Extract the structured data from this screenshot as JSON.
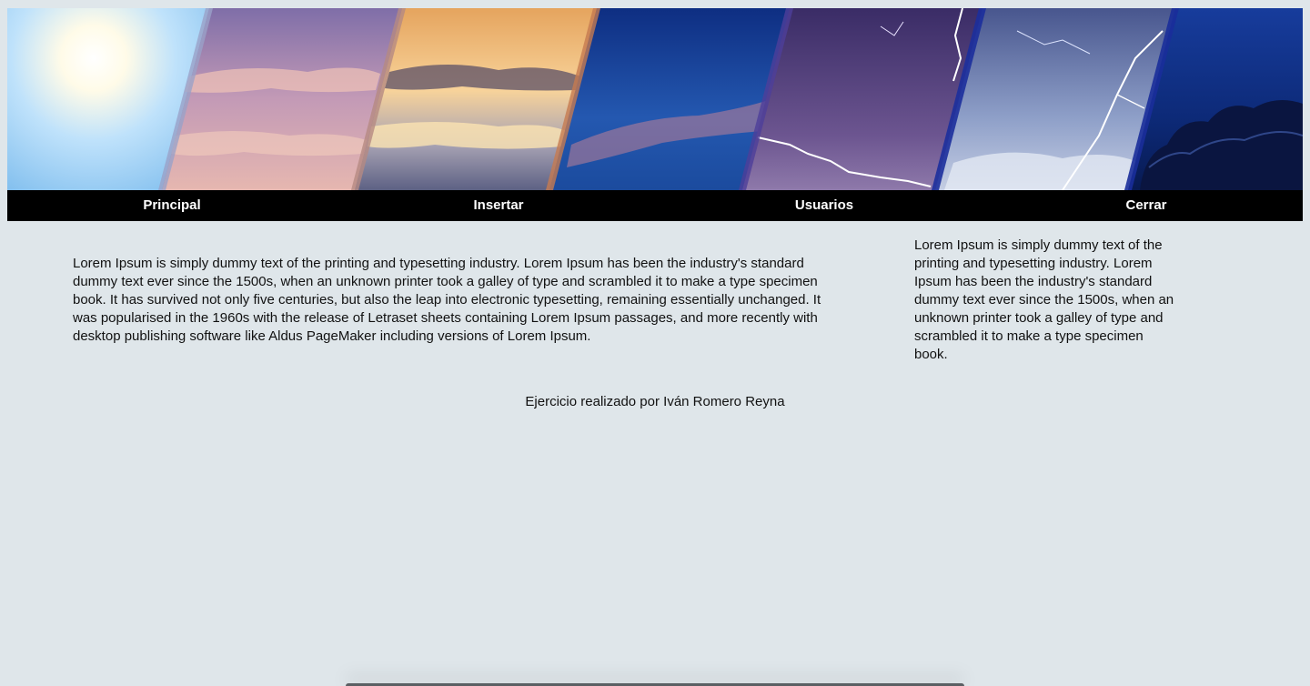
{
  "nav": {
    "items": [
      {
        "label": "Principal"
      },
      {
        "label": "Insertar"
      },
      {
        "label": "Usuarios"
      },
      {
        "label": "Cerrar"
      }
    ]
  },
  "content": {
    "main_paragraph": "Lorem Ipsum is simply dummy text of the printing and typesetting industry. Lorem Ipsum has been the industry's standard dummy text ever since the 1500s, when an unknown printer took a galley of type and scrambled it to make a type specimen book. It has survived not only five centuries, but also the leap into electronic typesetting, remaining essentially unchanged. It was popularised in the 1960s with the release of Letraset sheets containing Lorem Ipsum passages, and more recently with desktop publishing software like Aldus PageMaker including versions of Lorem Ipsum.",
    "side_paragraph": "Lorem Ipsum is simply dummy text of the printing and typesetting industry. Lorem Ipsum has been the industry's standard dummy text ever since the 1500s, when an unknown printer took a galley of type and scrambled it to make a type specimen book.",
    "footer": "Ejercicio realizado por Iván Romero Reyna"
  },
  "colors": {
    "background": "#dfe6ea",
    "navbar": "#000000",
    "nav_text": "#ffffff"
  }
}
